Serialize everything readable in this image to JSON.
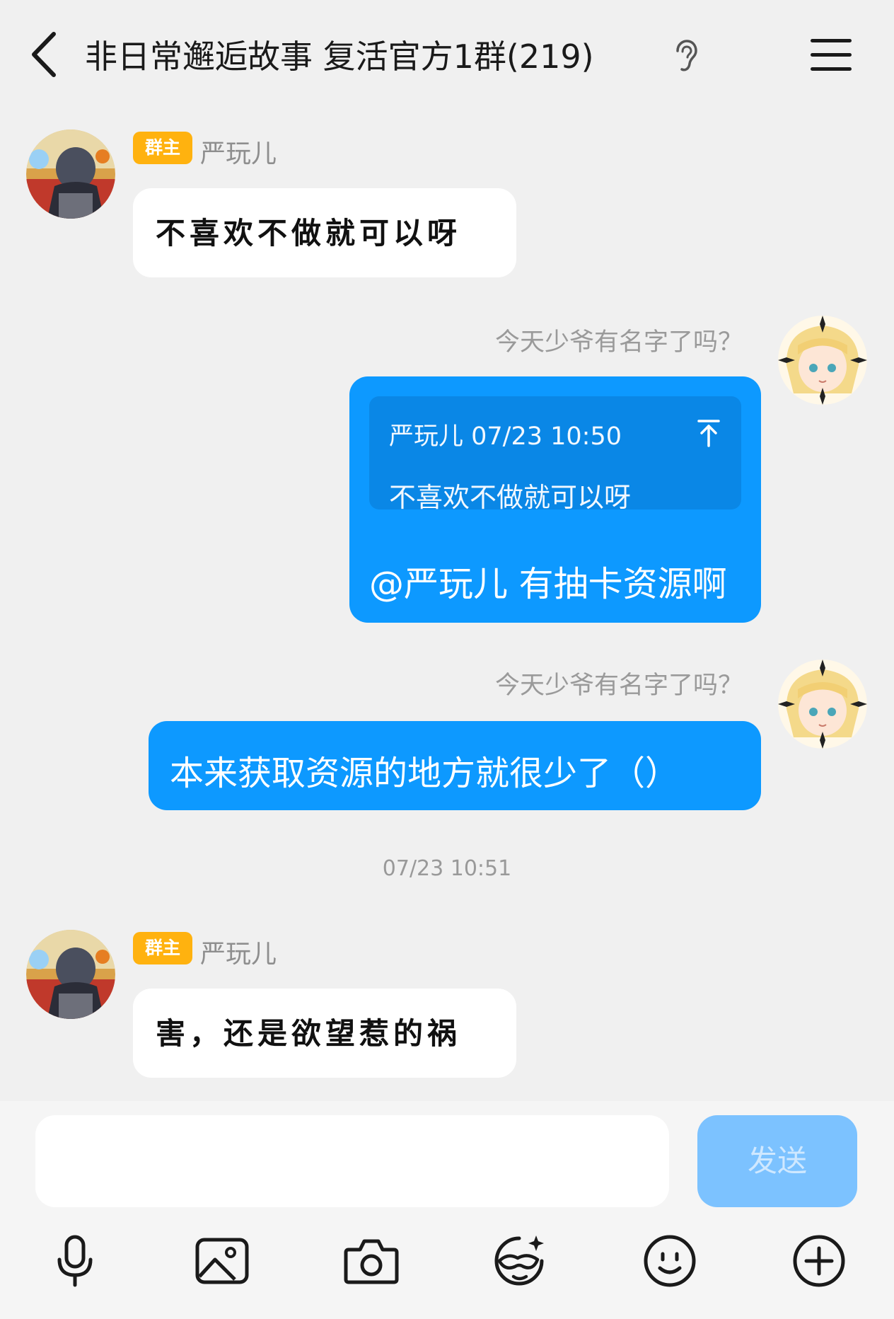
{
  "header": {
    "title": "非日常邂逅故事 复活官方1群(219)"
  },
  "messages": [
    {
      "badge": "群主",
      "name": "严玩儿",
      "text": "不喜欢不做就可以呀"
    },
    {
      "name": "今天少爷有名字了吗？",
      "quote_meta": "严玩儿 07/23 10:50",
      "quote_text": "不喜欢不做就可以呀",
      "text": "@严玩儿 有抽卡资源啊"
    },
    {
      "name": "今天少爷有名字了吗？",
      "text": "本来获取资源的地方就很少了（）"
    },
    {
      "timestamp": "07/23 10:51"
    },
    {
      "badge": "群主",
      "name": "严玩儿",
      "text": "害，还是欲望惹的祸"
    }
  ],
  "composer": {
    "input_value": "",
    "send_label": "发送"
  },
  "toolbar_icons": [
    "microphone-icon",
    "image-icon",
    "camera-icon",
    "sticker-icon",
    "emoji-icon",
    "plus-icon"
  ],
  "colors": {
    "background": "#f0f0f0",
    "outgoing_bubble": "#0d99ff",
    "quote_box": "#0a87e6",
    "owner_badge": "#ffb20f",
    "send_button_disabled": "#7cc2ff"
  }
}
